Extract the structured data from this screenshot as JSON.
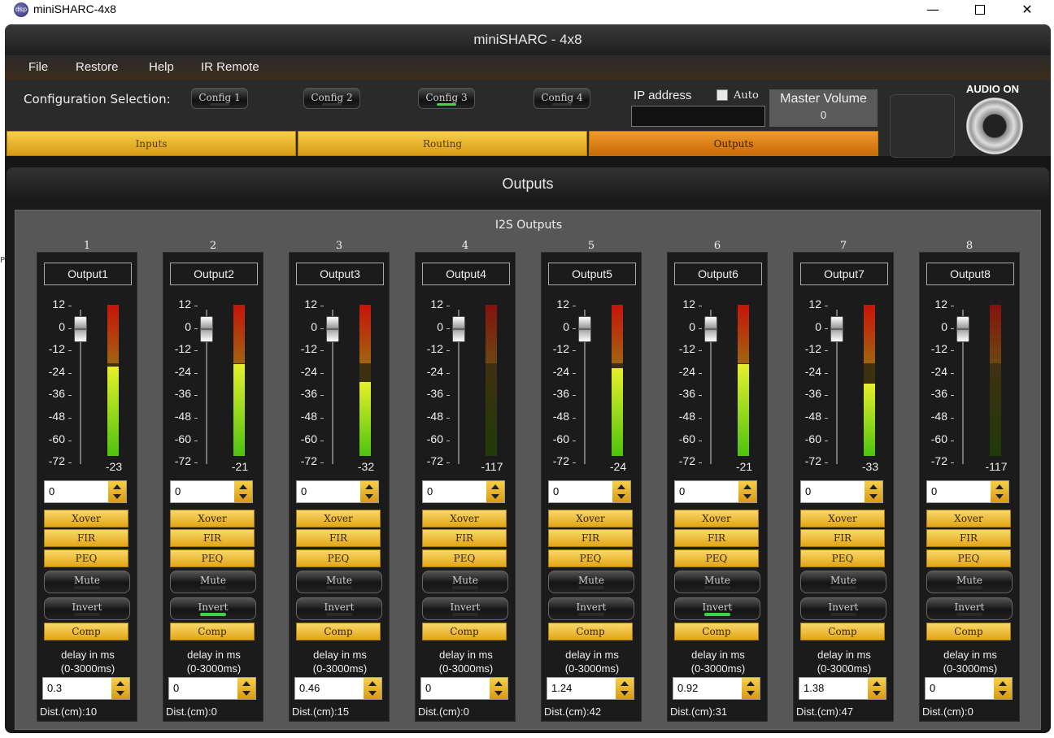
{
  "window": {
    "title": "miniSHARC-4x8",
    "icon": "app-logo-icon",
    "minimize": "—",
    "close": "✕"
  },
  "app": {
    "title": "miniSHARC - 4x8"
  },
  "menu": [
    "File",
    "Restore",
    "Help",
    "IR Remote"
  ],
  "config": {
    "label": "Configuration Selection:",
    "buttons": [
      {
        "label": "Config 1",
        "active": false
      },
      {
        "label": "Config 2",
        "active": false
      },
      {
        "label": "Config 3",
        "active": true
      },
      {
        "label": "Config 4",
        "active": false
      }
    ]
  },
  "ip": {
    "label": "IP address",
    "auto_label": "Auto",
    "auto_checked": false,
    "value": ""
  },
  "master_volume": {
    "label": "Master Volume",
    "value": "0"
  },
  "audio": {
    "label": "AUDIO ON",
    "icon": "speaker-icon"
  },
  "tabs": [
    {
      "label": "Inputs",
      "active": false
    },
    {
      "label": "Routing",
      "active": false
    },
    {
      "label": "Outputs",
      "active": true
    }
  ],
  "panel": {
    "title": "Outputs",
    "group_title": "I2S Outputs"
  },
  "scale": [
    "12",
    "0",
    "-12",
    "-24",
    "-36",
    "-48",
    "-60",
    "-72"
  ],
  "labels": {
    "xover": "Xover",
    "fir": "FIR",
    "peq": "PEQ",
    "mute": "Mute",
    "invert": "Invert",
    "comp": "Comp",
    "delay_line1": "delay in ms",
    "delay_line2": "(0-3000ms)"
  },
  "outputs": [
    {
      "num": "1",
      "name": "Output1",
      "level": "-23",
      "meter": 0.59,
      "gain": "0",
      "invert_on": false,
      "delay": "0.3",
      "dist": "Dist.(cm):10"
    },
    {
      "num": "2",
      "name": "Output2",
      "level": "-21",
      "meter": 0.61,
      "gain": "0",
      "invert_on": true,
      "delay": "0",
      "dist": "Dist.(cm):0"
    },
    {
      "num": "3",
      "name": "Output3",
      "level": "-32",
      "meter": 0.49,
      "gain": "0",
      "invert_on": false,
      "delay": "0.46",
      "dist": "Dist.(cm):15"
    },
    {
      "num": "4",
      "name": "Output4",
      "level": "-117",
      "meter": 0.0,
      "gain": "0",
      "invert_on": false,
      "delay": "0",
      "dist": "Dist.(cm):0"
    },
    {
      "num": "5",
      "name": "Output5",
      "level": "-24",
      "meter": 0.58,
      "gain": "0",
      "invert_on": false,
      "delay": "1.24",
      "dist": "Dist.(cm):42"
    },
    {
      "num": "6",
      "name": "Output6",
      "level": "-21",
      "meter": 0.61,
      "gain": "0",
      "invert_on": true,
      "delay": "0.92",
      "dist": "Dist.(cm):31"
    },
    {
      "num": "7",
      "name": "Output7",
      "level": "-33",
      "meter": 0.48,
      "gain": "0",
      "invert_on": false,
      "delay": "1.38",
      "dist": "Dist.(cm):47"
    },
    {
      "num": "8",
      "name": "Output8",
      "level": "-117",
      "meter": 0.0,
      "gain": "0",
      "invert_on": false,
      "delay": "0",
      "dist": "Dist.(cm):0"
    }
  ]
}
